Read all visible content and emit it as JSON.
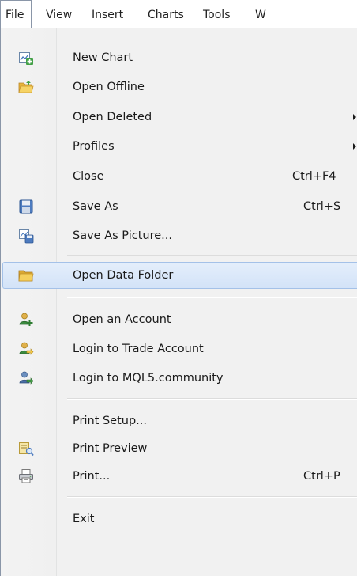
{
  "menubar": {
    "items": [
      "File",
      "View",
      "Insert",
      "Charts",
      "Tools",
      "W"
    ]
  },
  "file_menu": {
    "new_chart": "New Chart",
    "open_offline": "Open Offline",
    "open_deleted": "Open Deleted",
    "profiles": "Profiles",
    "close": "Close",
    "close_shortcut": "Ctrl+F4",
    "save_as": "Save As",
    "save_as_shortcut": "Ctrl+S",
    "save_as_picture": "Save As Picture...",
    "open_data_folder": "Open Data Folder",
    "open_account": "Open an Account",
    "login_trade": "Login to Trade Account",
    "login_mql5": "Login to MQL5.community",
    "print_setup": "Print Setup...",
    "print_preview": "Print Preview",
    "print": "Print...",
    "print_shortcut": "Ctrl+P",
    "exit": "Exit"
  },
  "colors": {
    "highlight": "#d3e3f8",
    "highlight_border": "#a4c1e8",
    "menu_background": "#f1f1f1"
  },
  "icons": {
    "new_chart": "new-chart-icon",
    "open_offline": "open-folder-icon",
    "save_as": "floppy-disk-icon",
    "save_as_picture": "save-picture-icon",
    "open_data_folder": "folder-icon",
    "open_account": "user-add-icon",
    "login_trade": "user-login-icon",
    "login_mql5": "community-login-icon",
    "print_preview": "print-preview-icon",
    "print": "printer-icon"
  }
}
